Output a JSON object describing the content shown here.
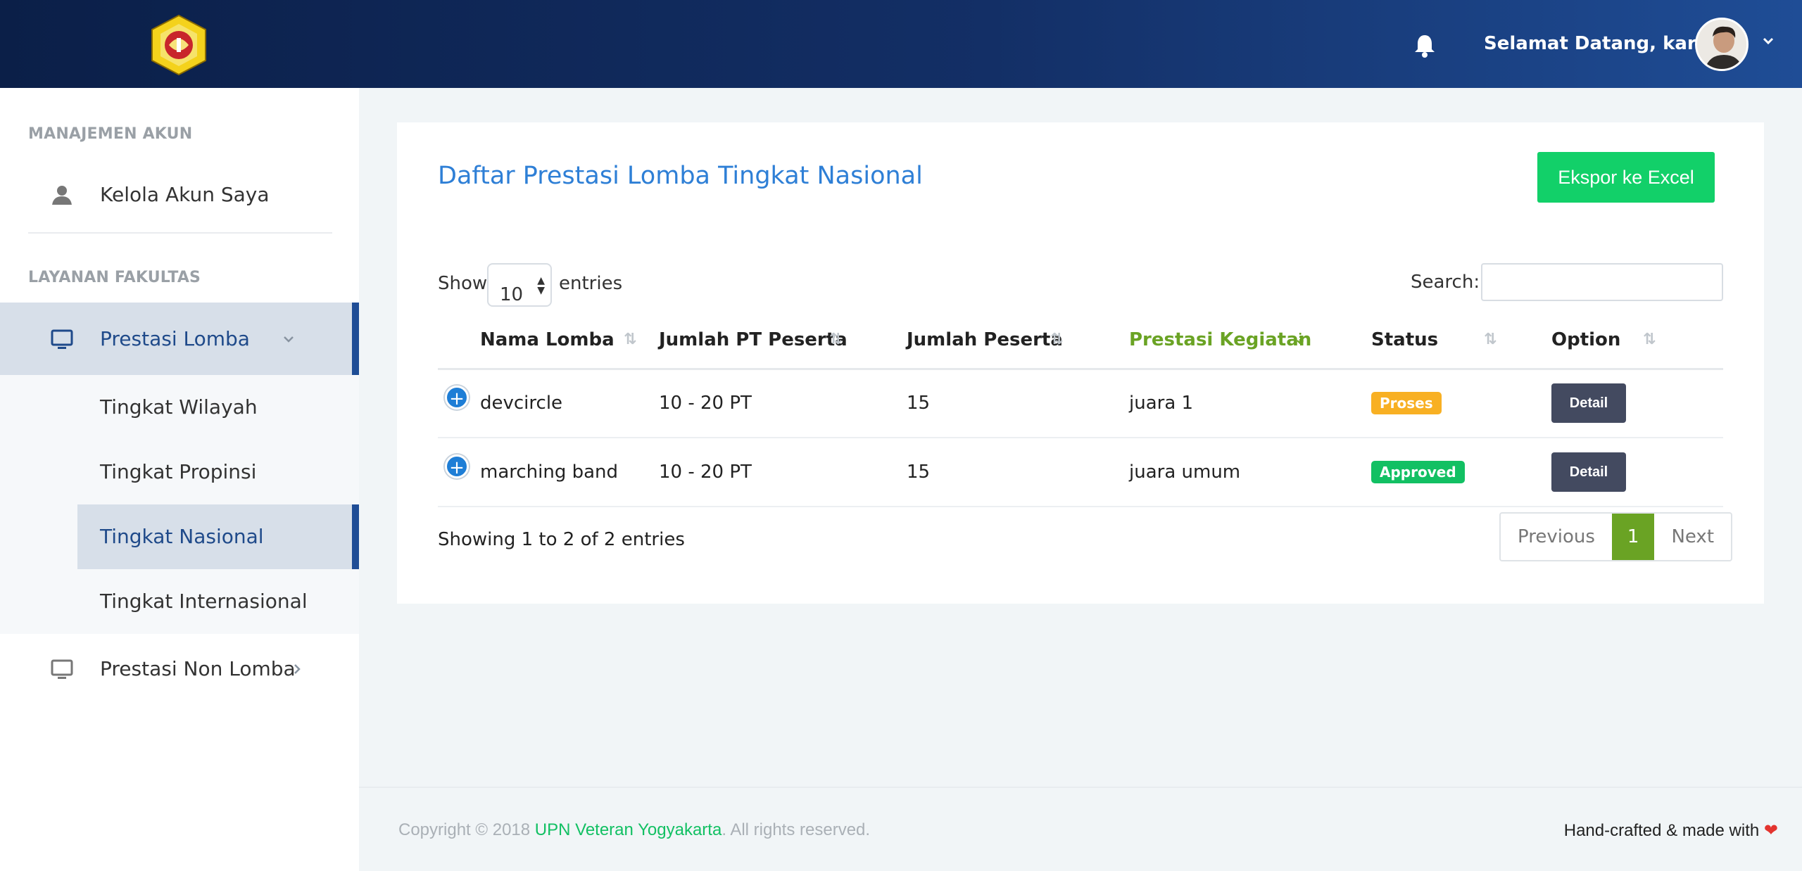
{
  "header": {
    "welcome_text": "Selamat Datang, karim"
  },
  "sidebar": {
    "section_account": "MANAJEMEN AKUN",
    "account_item": "Kelola Akun Saya",
    "section_faculty": "LAYANAN FAKULTAS",
    "prestasi_lomba": "Prestasi Lomba",
    "sub_items": [
      "Tingkat Wilayah",
      "Tingkat Propinsi",
      "Tingkat Nasional",
      "Tingkat Internasional"
    ],
    "prestasi_non_lomba": "Prestasi Non Lomba"
  },
  "card": {
    "title": "Daftar Prestasi Lomba Tingkat Nasional",
    "export_label": "Ekspor ke Excel",
    "show_label": "Show",
    "entries_value": "10",
    "entries_label": "entries",
    "search_label": "Search:",
    "search_value": "",
    "columns": [
      "Nama Lomba",
      "Jumlah PT Peserta",
      "Jumlah Peserta",
      "Prestasi Kegiatan",
      "Status",
      "Option"
    ],
    "rows": [
      {
        "nama": "devcircle",
        "pt": "10 - 20 PT",
        "peserta": "15",
        "prestasi": "juara 1",
        "status": "Proses",
        "option": "Detail"
      },
      {
        "nama": "marching band",
        "pt": "10 - 20 PT",
        "peserta": "15",
        "prestasi": "juara umum",
        "status": "Approved",
        "option": "Detail"
      }
    ],
    "info": "Showing 1 to 2 of 2 entries",
    "pager": {
      "previous": "Previous",
      "current": "1",
      "next": "Next"
    }
  },
  "footer": {
    "copyright_prefix": "Copyright © 2018 ",
    "brand": "UPN Veteran Yogyakarta",
    "copyright_suffix": ". All rights reserved.",
    "crafted": "Hand-crafted & made with "
  },
  "colors": {
    "accent": "#2e7fd6",
    "green": "#12d069",
    "sort_active": "#6aa324",
    "status_proses": "#f8b023",
    "status_approved": "#12c063",
    "header_dark": "#0b1f48"
  },
  "icons": {
    "bell": "bell-icon",
    "user": "user-icon",
    "monitor": "monitor-icon",
    "chevron_down": "chevron-down-icon",
    "chevron_right": "chevron-right-icon",
    "plus": "plus-circle-icon",
    "heart": "heart-icon"
  }
}
